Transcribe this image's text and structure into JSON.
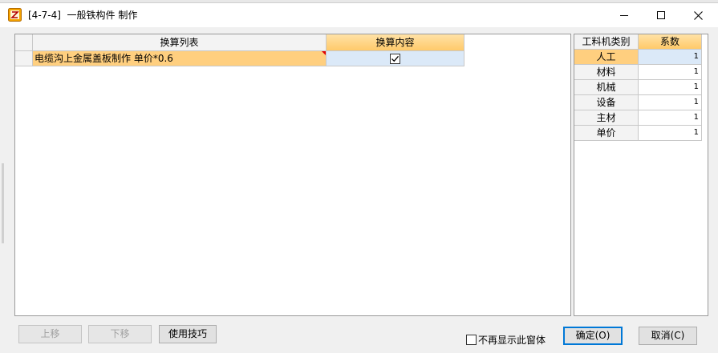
{
  "window": {
    "title": "[4-7-4]  一般铁构件 制作",
    "icon": "app-icon"
  },
  "main_grid": {
    "columns": [
      "换算列表",
      "换算内容"
    ],
    "rows": [
      {
        "list": "电缆沟上金属盖板制作 单价*0.6",
        "checked": true
      }
    ]
  },
  "side_grid": {
    "columns": [
      "工料机类别",
      "系数"
    ],
    "rows": [
      {
        "type": "人工",
        "coef": "1"
      },
      {
        "type": "材料",
        "coef": "1"
      },
      {
        "type": "机械",
        "coef": "1"
      },
      {
        "type": "设备",
        "coef": "1"
      },
      {
        "type": "主材",
        "coef": "1"
      },
      {
        "type": "单价",
        "coef": "1"
      }
    ]
  },
  "buttons": {
    "move_up": "上移",
    "move_down": "下移",
    "tips": "使用技巧",
    "ok": "确定(O)",
    "cancel": "取消(C)"
  },
  "no_show_label": "不再显示此窗体",
  "colors": {
    "header_highlight": "#ffca6a",
    "row_selected": "#ffcf7f",
    "cell_selected": "#dbe9f8",
    "accent": "#0078d7"
  }
}
